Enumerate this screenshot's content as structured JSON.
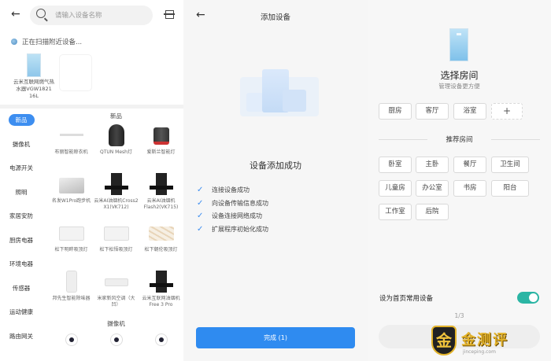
{
  "left_panel": {
    "search": {
      "placeholder": "请输入设备名称"
    },
    "scan_status": "正在扫描附近设备...",
    "found_device": {
      "label": "云米互联网燃气热水器VGW1821 16L"
    },
    "categories": [
      {
        "label": "新品",
        "active": true
      },
      {
        "label": "摄像机"
      },
      {
        "label": "电源开关"
      },
      {
        "label": "照明"
      },
      {
        "label": "家居安防"
      },
      {
        "label": "厨房电器"
      },
      {
        "label": "环境电器"
      },
      {
        "label": "传感器"
      },
      {
        "label": "运动健康"
      },
      {
        "label": "路由网关"
      }
    ],
    "section_new": "新品",
    "products": [
      {
        "label": "布丽智能晾衣机",
        "icon": "rail"
      },
      {
        "label": "QTUN Mesh灯",
        "icon": "cyl"
      },
      {
        "label": "爱斯兰智能灯",
        "icon": "cyl-red"
      },
      {
        "label": "名发W1Pro跑步机",
        "icon": "tread"
      },
      {
        "label": "云米AI油烟机Cross2 X1(VK712)",
        "icon": "hood"
      },
      {
        "label": "云米AI油烟机 Flash2(VK715)",
        "icon": "hood"
      },
      {
        "label": "松下明畔吸顶灯",
        "icon": "panel"
      },
      {
        "label": "松下松悟吸顶灯",
        "icon": "panel"
      },
      {
        "label": "松下朝伦吸顶灯",
        "icon": "panel-pat"
      },
      {
        "label": "邦先生智能除味器",
        "icon": "tower"
      },
      {
        "label": "米家新风空调（大凹）",
        "icon": "ac"
      },
      {
        "label": "云米互联网油烟机 Free 3 Pro",
        "icon": "hood"
      }
    ],
    "section_camera": "摄像机"
  },
  "middle_panel": {
    "title": "添加设备",
    "success_title": "设备添加成功",
    "steps": [
      "连接设备成功",
      "向设备传输信息成功",
      "设备连接网络成功",
      "扩展程序初始化成功"
    ],
    "done_button": "完成 (1)"
  },
  "right_panel": {
    "title": "选择房间",
    "subtitle": "管理设备更方便",
    "existing_rooms": [
      "厨房",
      "客厅",
      "浴室"
    ],
    "add_symbol": "+",
    "recommended_title": "推荐房间",
    "recommended_rooms": [
      "卧室",
      "主卧",
      "餐厅",
      "卫生间",
      "儿童房",
      "办公室",
      "书房",
      "阳台",
      "工作室",
      "后院"
    ],
    "toggle_label": "设为首页常用设备",
    "toggle_on": true,
    "pager": "1/3",
    "accent_color": "#2bb5a4"
  },
  "watermark": {
    "logo_char": "金",
    "text": "金测评",
    "sub": "jinceping.com"
  }
}
